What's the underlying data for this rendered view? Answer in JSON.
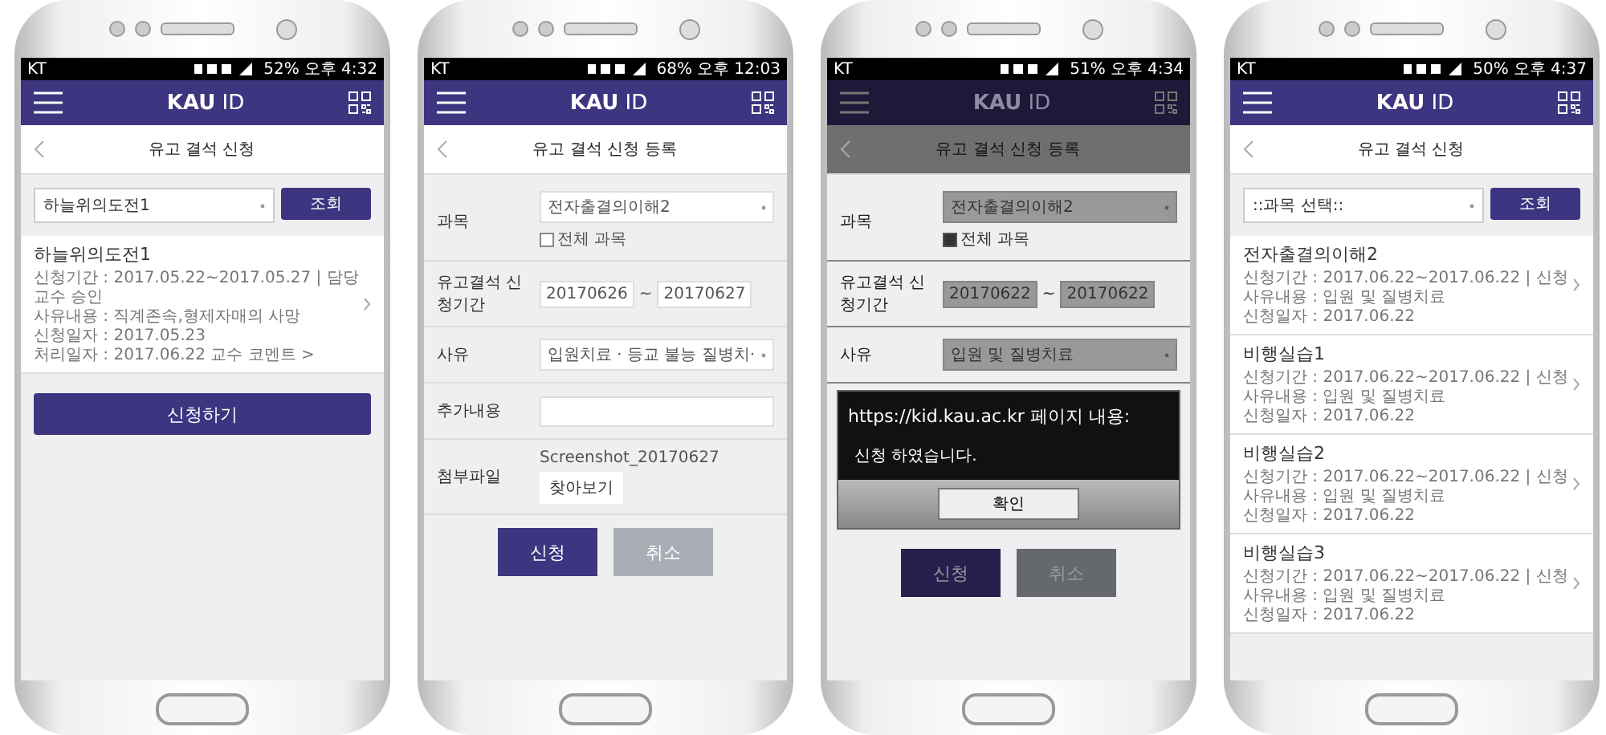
{
  "phones": [
    {
      "kind": "list",
      "status": {
        "carrier": "KT",
        "battery": "52%",
        "time": "오후 4:32"
      },
      "app_title": "**KAU** ID",
      "page_title": "유고 결석 신청",
      "filter": {
        "value": "하늘위의도전1",
        "button": "조회"
      },
      "cards": [
        {
          "title": "하늘위의도전1",
          "lines": [
            "신청기간 : 2017.05.22~2017.05.27 | 담당교수 승인",
            "사유내용 : 직계존속,형제자매의 사망",
            "신청일자 : 2017.05.23",
            "처리일자 : 2017.06.22 교수 코멘트 >"
          ]
        }
      ],
      "action_button": "신청하기"
    },
    {
      "kind": "form",
      "dimmed": false,
      "status": {
        "carrier": "KT",
        "battery": "68%",
        "time": "오후 12:03"
      },
      "app_title": "**KAU** ID",
      "page_title": "유고 결석 신청 등록",
      "rows": [
        {
          "kind": "select",
          "label": "과목",
          "value": "전자출결의이해2",
          "checkbox": {
            "label": "전체 과목",
            "checked": false
          }
        },
        {
          "kind": "daterange",
          "label": "유고결석 신청기간",
          "from": "20170626",
          "separator": "~",
          "to": "20170627"
        },
        {
          "kind": "select",
          "label": "사유",
          "value": "입원치료 · 등교 불능 질병치·"
        },
        {
          "kind": "text",
          "label": "추가내용"
        },
        {
          "kind": "file",
          "label": "첨부파일",
          "value": "Screenshot_20170627",
          "button": "찾아보기"
        }
      ],
      "buttons": [
        {
          "label": "신청",
          "disabled": false
        },
        {
          "label": "취소",
          "disabled": true
        }
      ]
    },
    {
      "kind": "form",
      "dimmed": true,
      "status": {
        "carrier": "KT",
        "battery": "51%",
        "time": "오후 4:34"
      },
      "app_title": "**KAU** ID",
      "page_title": "유고 결석 신청 등록",
      "rows": [
        {
          "kind": "select",
          "label": "과목",
          "value": "전자출결의이해2",
          "checkbox": {
            "label": "전체 과목",
            "checked": true
          }
        },
        {
          "kind": "daterange",
          "label": "유고결석 신청기간",
          "from": "20170622",
          "separator": "~",
          "to": "20170622"
        },
        {
          "kind": "select",
          "label": "사유",
          "value": "입원 및 질병치료"
        }
      ],
      "dialog": {
        "title": "https://kid.kau.ac.kr 페이지 내용:",
        "message": "신청 하였습니다.",
        "button": "확인"
      },
      "buttons": [
        {
          "label": "신청",
          "disabled": false
        },
        {
          "label": "취소",
          "disabled": true
        }
      ]
    },
    {
      "kind": "list",
      "status": {
        "carrier": "KT",
        "battery": "50%",
        "time": "오후 4:37"
      },
      "app_title": "**KAU** ID",
      "page_title": "유고 결석 신청",
      "filter": {
        "value": "::과목 선택::",
        "button": "조회"
      },
      "cards": [
        {
          "title": "전자출결의이해2",
          "lines": [
            "신청기간 : 2017.06.22~2017.06.22 | 신청",
            "사유내용 : 입원 및 질병치료",
            "신청일자 : 2017.06.22"
          ]
        },
        {
          "title": "비행실습1",
          "lines": [
            "신청기간 : 2017.06.22~2017.06.22 | 신청",
            "사유내용 : 입원 및 질병치료",
            "신청일자 : 2017.06.22"
          ]
        },
        {
          "title": "비행실습2",
          "lines": [
            "신청기간 : 2017.06.22~2017.06.22 | 신청",
            "사유내용 : 입원 및 질병치료",
            "신청일자 : 2017.06.22"
          ]
        },
        {
          "title": "비행실습3",
          "lines": [
            "신청기간 : 2017.06.22~2017.06.22 | 신청",
            "사유내용 : 입원 및 질병치료",
            "신청일자 : 2017.06.22"
          ]
        }
      ]
    }
  ]
}
